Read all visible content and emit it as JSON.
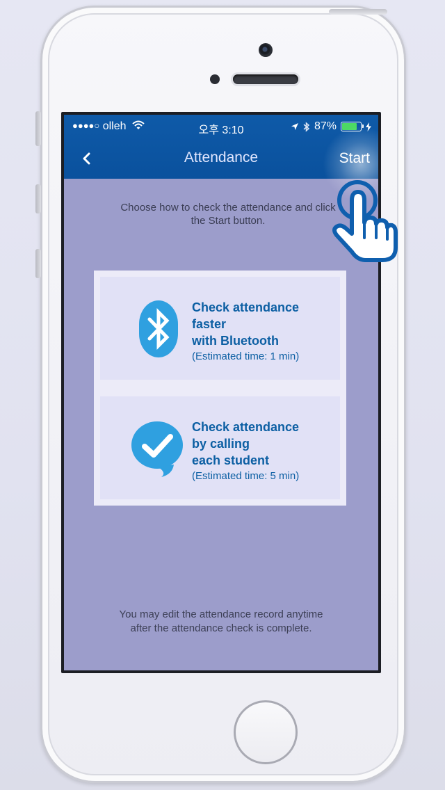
{
  "status_bar": {
    "carrier": "olleh",
    "time": "오후 3:10",
    "battery": "87%",
    "battery_level": 0.87
  },
  "nav": {
    "title": "Attendance",
    "start_label": "Start"
  },
  "instruction": "Choose how to check the attendance and click\nthe Start button.",
  "options": [
    {
      "title": "Check attendance\nfaster\nwith Bluetooth",
      "estimate": "(Estimated time: 1 min)",
      "icon": "bluetooth-icon"
    },
    {
      "title": "Check attendance\nby calling\neach student",
      "estimate": "(Estimated time: 5 min)",
      "icon": "checkmark-bubble-icon"
    }
  ],
  "footer": "You may edit the attendance record anytime\nafter the attendance check is complete.",
  "colors": {
    "nav_bar": "#0b57a6",
    "background": "#9c9dcb",
    "option_text": "#0c5fa3",
    "icon_blue": "#2fa0e0"
  }
}
